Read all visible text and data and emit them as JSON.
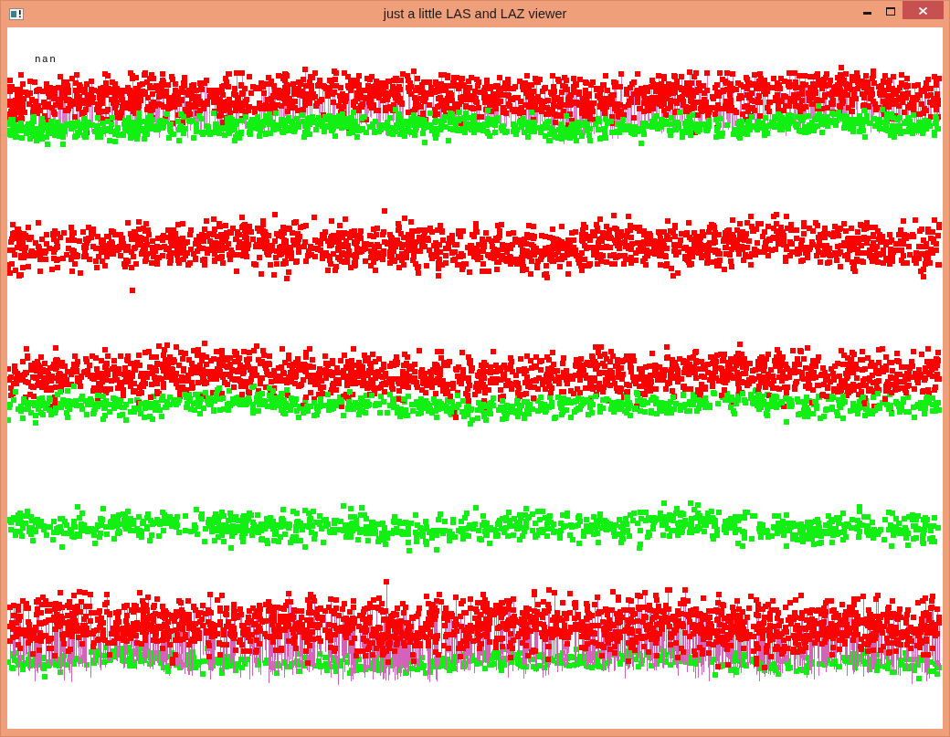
{
  "window": {
    "title": "just a little LAS and LAZ viewer"
  },
  "viewport": {
    "label": "nan"
  }
}
